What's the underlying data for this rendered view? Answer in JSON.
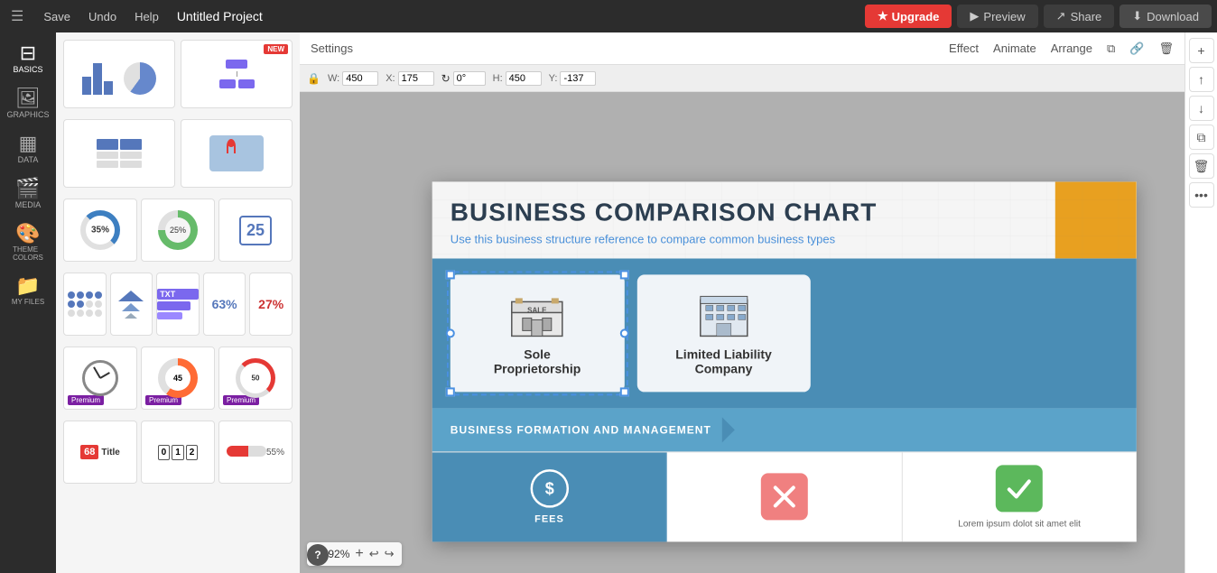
{
  "topbar": {
    "menu_label": "☰",
    "save_label": "Save",
    "undo_label": "Undo",
    "help_label": "Help",
    "project_title": "Untitled Project",
    "upgrade_label": "Upgrade",
    "preview_label": "Preview",
    "share_label": "Share",
    "download_label": "Download"
  },
  "settings_bar": {
    "title": "Settings",
    "effect_label": "Effect",
    "animate_label": "Animate",
    "arrange_label": "Arrange"
  },
  "transform": {
    "w_label": "W:",
    "w_value": "450",
    "x_label": "X:",
    "x_value": "175",
    "rotation_value": "0°",
    "h_label": "H:",
    "h_value": "450",
    "y_label": "Y:",
    "y_value": "-137"
  },
  "sidebar": {
    "items": [
      {
        "id": "basics",
        "label": "Basics",
        "icon": "⊞"
      },
      {
        "id": "graphics",
        "label": "Graphics",
        "icon": "🖼"
      },
      {
        "id": "data",
        "label": "Data",
        "icon": "📊"
      },
      {
        "id": "media",
        "label": "Media",
        "icon": "🎬"
      },
      {
        "id": "theme-colors",
        "label": "Theme Colors",
        "icon": "🎨"
      },
      {
        "id": "my-files",
        "label": "My Files",
        "icon": "📁"
      }
    ]
  },
  "infographic": {
    "title": "BUSINESS COMPARISON CHART",
    "subtitle": "Use this business structure reference to compare common business types",
    "cards": [
      {
        "id": "sole-prop",
        "icon": "🏪",
        "title": "Sole\nProprietorship"
      },
      {
        "id": "llc",
        "icon": "🏢",
        "title": "Limited Liability\nCompany"
      }
    ],
    "section_header": "BUSINESS FORMATION AND MANAGEMENT",
    "fees_label": "FEES",
    "lorem_text": "Lorem ipsum dolot sit amet elit"
  },
  "zoom": {
    "value": "92%"
  },
  "right_toolbar": {
    "add_icon": "+",
    "up_icon": "↑",
    "down_icon": "↓",
    "copy_icon": "⧉",
    "delete_icon": "🗑",
    "more_icon": "•••"
  },
  "panel": {
    "sections": [
      {
        "items": [
          {
            "type": "bar-pie",
            "has_new": false
          },
          {
            "type": "org-chart",
            "has_new": true
          }
        ]
      },
      {
        "items": [
          {
            "type": "table",
            "has_new": false
          },
          {
            "type": "map",
            "has_new": false
          }
        ]
      },
      {
        "items": [
          {
            "type": "ring-35",
            "has_new": false
          },
          {
            "type": "gauge-green",
            "has_new": false
          },
          {
            "type": "counter-25",
            "has_new": false
          }
        ]
      },
      {
        "items": [
          {
            "type": "dots-grid",
            "has_new": false
          },
          {
            "type": "triangles",
            "has_new": false
          },
          {
            "type": "txt-bar",
            "has_new": false
          },
          {
            "type": "pct-63",
            "has_new": false
          },
          {
            "type": "pct-27",
            "has_new": false
          }
        ]
      },
      {
        "items": [
          {
            "type": "clock",
            "has_new": false,
            "premium": true
          },
          {
            "type": "gauge-45",
            "has_new": false,
            "premium": true
          },
          {
            "type": "speedometer",
            "has_new": false,
            "premium": true
          }
        ]
      },
      {
        "items": [
          {
            "type": "title-68",
            "has_new": false,
            "premium": false
          },
          {
            "type": "counter-012",
            "has_new": false,
            "premium": false
          },
          {
            "type": "pct-55",
            "has_new": false,
            "premium": false
          }
        ]
      }
    ]
  }
}
